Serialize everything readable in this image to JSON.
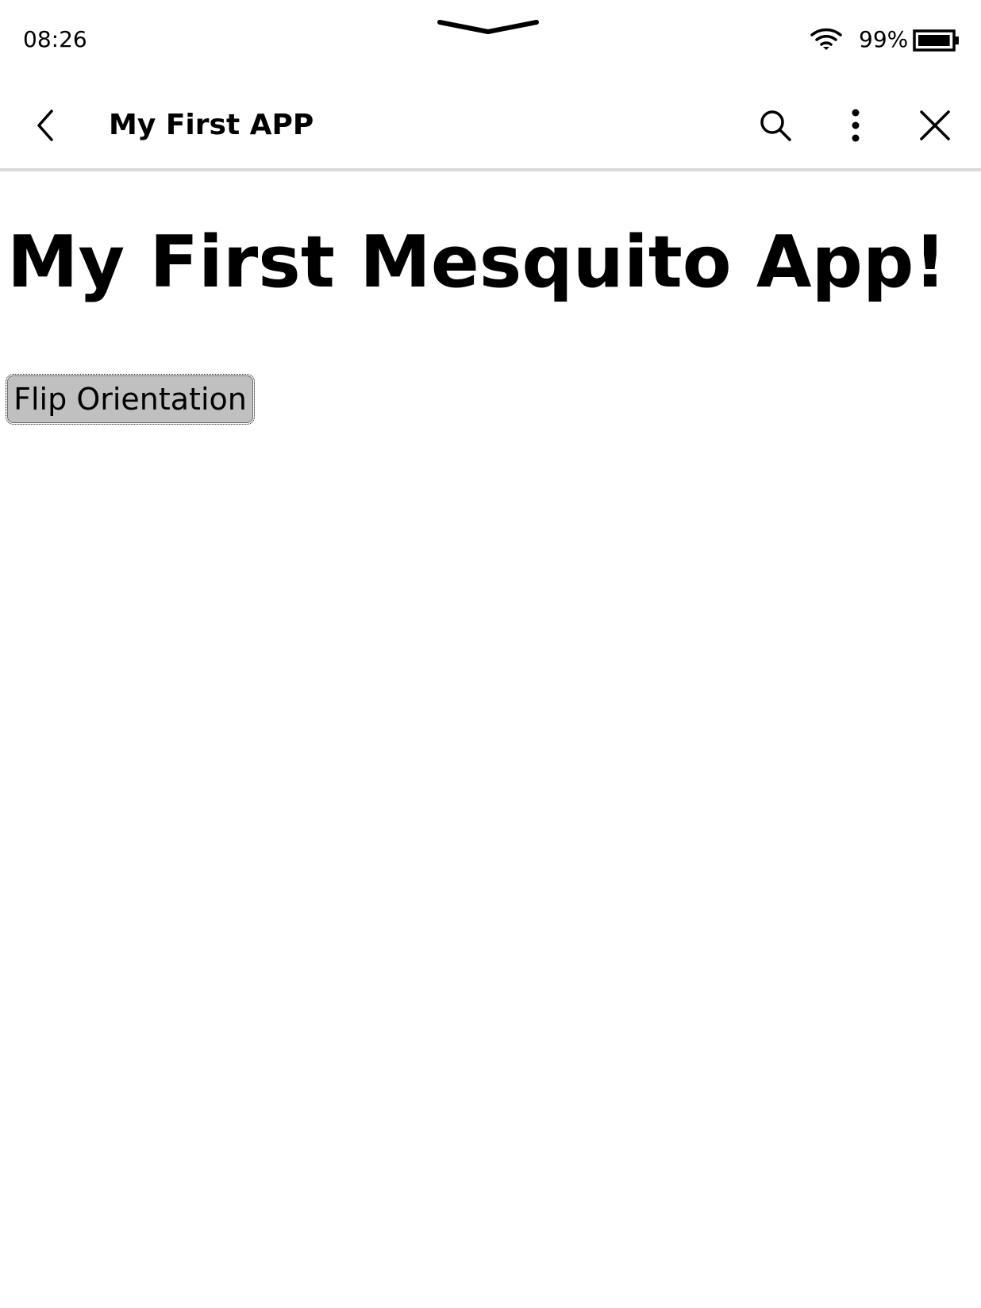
{
  "status_bar": {
    "time": "08:26",
    "battery_percent": "99%",
    "battery_level": 0.99,
    "icons": [
      "pulldown-handle",
      "wifi-icon",
      "battery-icon"
    ]
  },
  "title_bar": {
    "title": "My First APP",
    "icons": [
      "back-icon",
      "search-icon",
      "more-vertical-icon",
      "close-icon"
    ]
  },
  "content": {
    "heading": "My First Mesquito App!",
    "flip_button_label": "Flip Orientation"
  },
  "colors": {
    "background": "#ffffff",
    "text": "#000000",
    "divider": "#d9d9d9",
    "button_fill": "#c0c0c0"
  }
}
